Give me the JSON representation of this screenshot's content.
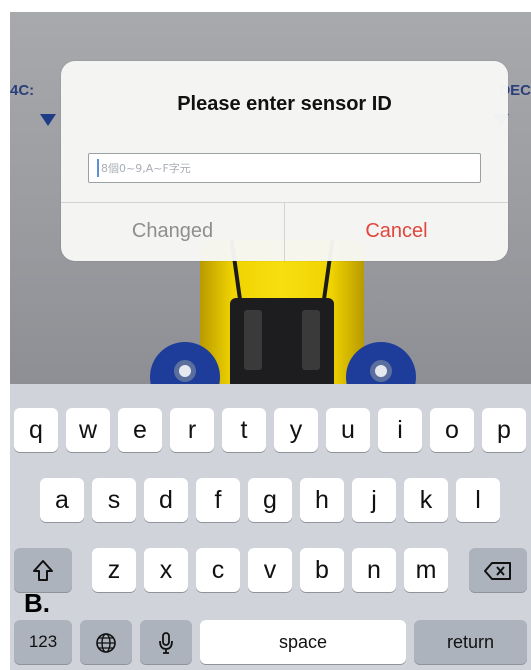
{
  "app": {
    "left_label": "4C:",
    "right_label": "DEC"
  },
  "dialog": {
    "title": "Please enter sensor ID",
    "input_value": "",
    "input_placeholder": "8個0~9,A~F字元",
    "buttons": {
      "changed": "Changed",
      "cancel": "Cancel"
    },
    "colors": {
      "cancel": "#e0473d",
      "changed": "#8e8e8e"
    }
  },
  "keyboard": {
    "row1": [
      "q",
      "w",
      "e",
      "r",
      "t",
      "y",
      "u",
      "i",
      "o",
      "p"
    ],
    "row2": [
      "a",
      "s",
      "d",
      "f",
      "g",
      "h",
      "j",
      "k",
      "l"
    ],
    "row3": [
      "z",
      "x",
      "c",
      "v",
      "b",
      "n",
      "m"
    ],
    "shift_icon": "shift-icon",
    "backspace_icon": "backspace-icon",
    "numbers_label": "123",
    "globe_icon": "globe-icon",
    "mic_icon": "microphone-icon",
    "space_label": "space",
    "return_label": "return"
  },
  "annotation": {
    "label": "B."
  }
}
